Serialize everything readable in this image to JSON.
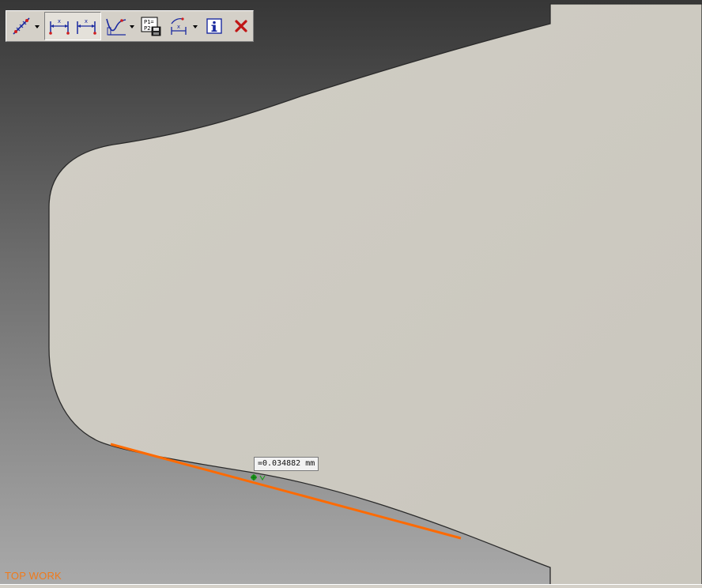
{
  "viewport": {
    "bg_top_color": "#3a3a3a",
    "bg_bottom_color": "#a7a7a7",
    "part_color": "#ccc9c0",
    "measure_line_color": "#ff6a00",
    "point_color": "#1f9d1f"
  },
  "toolbar": {
    "buttons": [
      {
        "name": "measure-distance-icon",
        "has_dropdown": true
      },
      {
        "name": "horizontal-dimension-icon"
      },
      {
        "name": "horizontal-dimension-alt-icon"
      },
      {
        "name": "curve-deviation-icon",
        "has_dropdown": true
      },
      {
        "name": "save-points-icon"
      },
      {
        "name": "angle-dimension-icon",
        "has_dropdown": true
      },
      {
        "name": "info-icon"
      },
      {
        "name": "close-icon"
      }
    ],
    "save_points_label": "P1=\nP2"
  },
  "measurement": {
    "value": "=0.034882 mm"
  },
  "view_label": "TOP WORK"
}
